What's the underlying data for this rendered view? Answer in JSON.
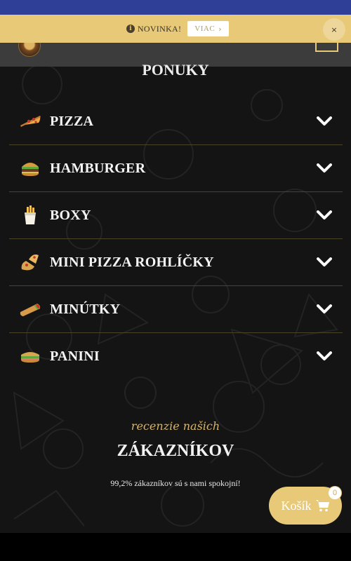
{
  "notice": {
    "info_icon": "info-circle-icon",
    "text": "NOVINKA!",
    "more_label": "VIAC",
    "close_label": "×"
  },
  "header": {
    "logo_icon": "restaurant-logo",
    "menu_icon": "menu-toggle-icon"
  },
  "offers": {
    "title": "PONUKY",
    "categories": [
      {
        "label": "PIZZA",
        "icon": "pizza-slice-icon"
      },
      {
        "label": "HAMBURGER",
        "icon": "hamburger-icon"
      },
      {
        "label": "BOXY",
        "icon": "fries-box-icon"
      },
      {
        "label": "MINI PIZZA ROHLÍČKY",
        "icon": "mini-pizza-roll-icon"
      },
      {
        "label": "MINÚTKY",
        "icon": "wrap-icon"
      },
      {
        "label": "PANINI",
        "icon": "panini-sandwich-icon"
      }
    ]
  },
  "reviews": {
    "script_line": "recenzie našich",
    "title": "ZÁKAZNÍKOV",
    "summary": "99,2% zákazníkov sú s nami spokojní!"
  },
  "cart": {
    "label": "Košík",
    "icon": "shopping-cart-icon",
    "count": "0"
  },
  "colors": {
    "accent": "#e8c978",
    "background": "#141414",
    "top_strip": "#2f3e96"
  }
}
